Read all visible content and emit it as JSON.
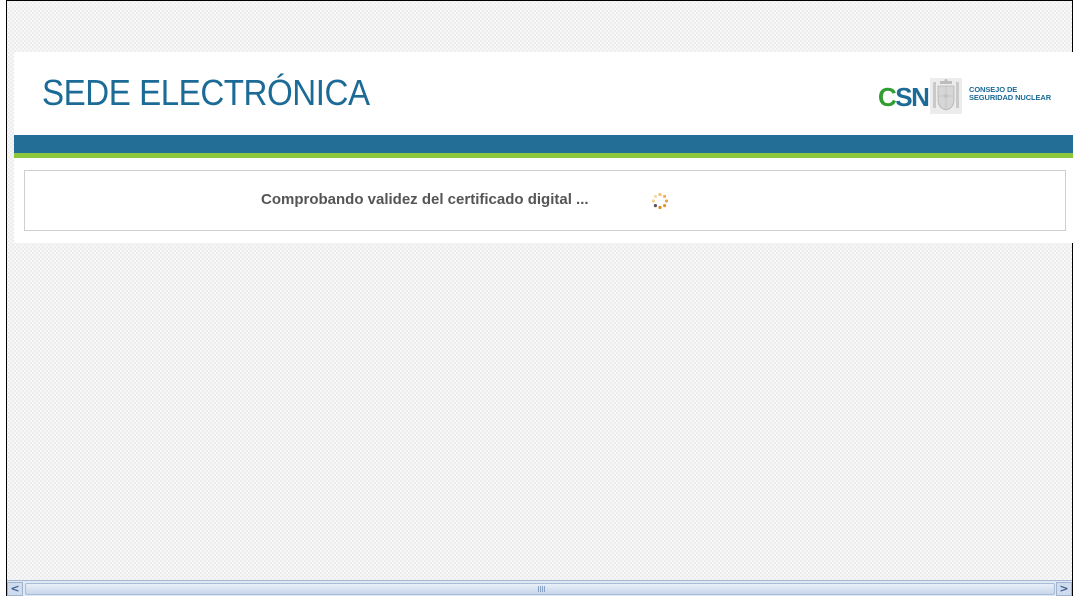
{
  "header": {
    "site_title": "SEDE ELECTRÓNICA",
    "logo": {
      "acronym_part1": "C",
      "acronym_part2": "SN",
      "line1": "CONSEJO DE",
      "line2": "SEGURIDAD NUCLEAR",
      "emblem_icon": "coat-of-arms-icon"
    }
  },
  "status": {
    "message": "Comprobando validez del certificado digital ...",
    "icon": "loading-spinner-icon"
  },
  "scrollbar": {
    "left_arrow": "<",
    "right_arrow": ">"
  },
  "colors": {
    "brand_blue": "#236e96",
    "brand_green": "#8cc63f",
    "title_blue": "#1b6b96",
    "logo_green": "#2f9d2f",
    "spinner_orange": "#e08a1e"
  }
}
